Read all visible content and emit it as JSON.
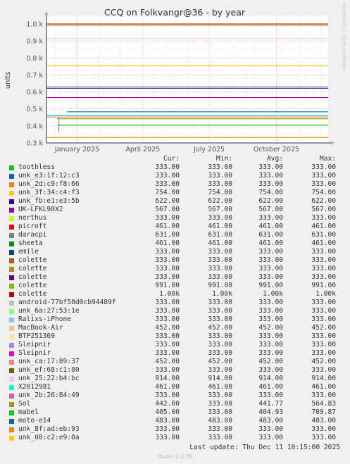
{
  "title": "CCQ on Folkvangr@36 - by year",
  "watermark": "RRDTOOL / TOBI OETIKER",
  "last_update": "Last update: Thu Dec 11 10:15:00 2025",
  "generator": "Munin 2.0.76",
  "legend_header": {
    "cur": "Cur:",
    "min": "Min:",
    "avg": "Avg:",
    "max": "Max:"
  },
  "chart_data": {
    "type": "line",
    "title": "CCQ on Folkvangr@36 - by year",
    "ylabel": "units",
    "ylim": [
      0.3,
      1.05
    ],
    "yticks": [
      {
        "value": 0.3,
        "label": "0.3 k"
      },
      {
        "value": 0.4,
        "label": "0.4 k"
      },
      {
        "value": 0.5,
        "label": "0.5 k"
      },
      {
        "value": 0.6,
        "label": "0.6 k"
      },
      {
        "value": 0.7,
        "label": "0.7 k"
      },
      {
        "value": 0.8,
        "label": "0.8 k"
      },
      {
        "value": 0.9,
        "label": "0.9 k"
      },
      {
        "value": 1.0,
        "label": "1.0 k"
      }
    ],
    "x_range": [
      "2024-11-20",
      "2025-12-11"
    ],
    "xticks": [
      {
        "date": "2025-01-01",
        "label": "January 2025"
      },
      {
        "date": "2025-04-01",
        "label": "April 2025"
      },
      {
        "date": "2025-07-01",
        "label": "July 2025"
      },
      {
        "date": "2025-10-01",
        "label": "October 2025"
      }
    ],
    "grid": true,
    "series": [
      {
        "name": "toothless",
        "color": "#00cc00",
        "cur": "333.00",
        "min": "333.00",
        "avg": "333.00",
        "max": "333.00",
        "level": 333
      },
      {
        "name": "unk_e3:1f:12:c3",
        "color": "#0066b3",
        "cur": "333.00",
        "min": "333.00",
        "avg": "333.00",
        "max": "333.00",
        "level": 333
      },
      {
        "name": "unk_2d:c9:f8:66",
        "color": "#ff8000",
        "cur": "333.00",
        "min": "333.00",
        "avg": "333.00",
        "max": "333.00",
        "level": 333
      },
      {
        "name": "unk_3f:34:c4:f3",
        "color": "#ffcc00",
        "cur": "754.00",
        "min": "754.00",
        "avg": "754.00",
        "max": "754.00",
        "level": 754
      },
      {
        "name": "unk_fb:e1:e3:5b",
        "color": "#330099",
        "cur": "622.00",
        "min": "622.00",
        "avg": "622.00",
        "max": "622.00",
        "level": 622
      },
      {
        "name": "UK-LFKL90X2",
        "color": "#990099",
        "cur": "567.00",
        "min": "567.00",
        "avg": "567.00",
        "max": "567.00",
        "level": 567
      },
      {
        "name": "nerthus",
        "color": "#ccff00",
        "cur": "333.00",
        "min": "333.00",
        "avg": "333.00",
        "max": "333.00",
        "level": 333
      },
      {
        "name": "picroft",
        "color": "#ff0000",
        "cur": "461.00",
        "min": "461.00",
        "avg": "461.00",
        "max": "461.00",
        "level": 461
      },
      {
        "name": "daracpi",
        "color": "#808080",
        "cur": "631.00",
        "min": "631.00",
        "avg": "631.00",
        "max": "631.00",
        "level": 631
      },
      {
        "name": "sheeta",
        "color": "#008f00",
        "cur": "461.00",
        "min": "461.00",
        "avg": "461.00",
        "max": "461.00",
        "level": 461
      },
      {
        "name": "emile",
        "color": "#00487d",
        "cur": "333.00",
        "min": "333.00",
        "avg": "333.00",
        "max": "333.00",
        "level": 333
      },
      {
        "name": "colette",
        "color": "#b35a00",
        "cur": "333.00",
        "min": "333.00",
        "avg": "333.00",
        "max": "333.00",
        "level": 333
      },
      {
        "name": "colette",
        "color": "#b38f00",
        "cur": "333.00",
        "min": "333.00",
        "avg": "333.00",
        "max": "333.00",
        "level": 333
      },
      {
        "name": "colette",
        "color": "#6b006b",
        "cur": "333.00",
        "min": "333.00",
        "avg": "333.00",
        "max": "333.00",
        "level": 333
      },
      {
        "name": "colette",
        "color": "#8fb300",
        "cur": "991.00",
        "min": "991.00",
        "avg": "991.00",
        "max": "991.00",
        "level": 991
      },
      {
        "name": "colette",
        "color": "#b30000",
        "cur": "1.00k",
        "min": "1.00k",
        "avg": "1.00k",
        "max": "1.00k",
        "level": 1000
      },
      {
        "name": "android-77bf50d0cb94489f",
        "color": "#bebebe",
        "cur": "333.00",
        "min": "333.00",
        "avg": "333.00",
        "max": "333.00",
        "level": 333
      },
      {
        "name": "unk_6a:27:53:1e",
        "color": "#80ff80",
        "cur": "333.00",
        "min": "333.00",
        "avg": "333.00",
        "max": "333.00",
        "level": 333
      },
      {
        "name": "Ralixs-iPhone",
        "color": "#80c9ff",
        "cur": "333.00",
        "min": "333.00",
        "avg": "333.00",
        "max": "333.00",
        "level": 333
      },
      {
        "name": "MacBook-Air",
        "color": "#ffc080",
        "cur": "452.00",
        "min": "452.00",
        "avg": "452.00",
        "max": "452.00",
        "level": 452
      },
      {
        "name": "BTP251369",
        "color": "#ffe680",
        "cur": "333.00",
        "min": "333.00",
        "avg": "333.00",
        "max": "333.00",
        "level": 333
      },
      {
        "name": "Sleipnir",
        "color": "#aa80ff",
        "cur": "333.00",
        "min": "333.00",
        "avg": "333.00",
        "max": "333.00",
        "level": 333
      },
      {
        "name": "Sleipnir",
        "color": "#ee00cc",
        "cur": "333.00",
        "min": "333.00",
        "avg": "333.00",
        "max": "333.00",
        "level": 333
      },
      {
        "name": "unk_ca:17:89:37",
        "color": "#ff8080",
        "cur": "452.00",
        "min": "452.00",
        "avg": "452.00",
        "max": "452.00",
        "level": 452
      },
      {
        "name": "unk_ef:68:c1:80",
        "color": "#666600",
        "cur": "333.00",
        "min": "333.00",
        "avg": "333.00",
        "max": "333.00",
        "level": 333
      },
      {
        "name": "unk_25:22:b4:bc",
        "color": "#ffbfff",
        "cur": "914.00",
        "min": "914.00",
        "avg": "914.00",
        "max": "914.00",
        "level": 914
      },
      {
        "name": "X2012981",
        "color": "#00ffcc",
        "cur": "461.00",
        "min": "461.00",
        "avg": "461.00",
        "max": "461.00",
        "level": 461
      },
      {
        "name": "unk_2b:26:84:49",
        "color": "#cc6699",
        "cur": "333.00",
        "min": "333.00",
        "avg": "333.00",
        "max": "333.00",
        "level": 333
      },
      {
        "name": "Sol",
        "color": "#999900",
        "cur": "442.00",
        "min": "333.00",
        "avg": "441.77",
        "max": "564.83",
        "level": 442
      },
      {
        "name": "mabel",
        "color": "#00cc00",
        "cur": "405.00",
        "min": "333.00",
        "avg": "404.93",
        "max": "789.87",
        "level": 405
      },
      {
        "name": "moto-e14",
        "color": "#0066b3",
        "cur": "483.00",
        "min": "483.00",
        "avg": "483.00",
        "max": "483.00",
        "level": 483
      },
      {
        "name": "unk_8f:ad:eb:93",
        "color": "#ff8000",
        "cur": "333.00",
        "min": "333.00",
        "avg": "333.00",
        "max": "333.00",
        "level": 333
      },
      {
        "name": "unk_08:c2:e9:8a",
        "color": "#ffcc00",
        "cur": "333.00",
        "min": "333.00",
        "avg": "333.00",
        "max": "333.00",
        "level": 333
      }
    ]
  }
}
